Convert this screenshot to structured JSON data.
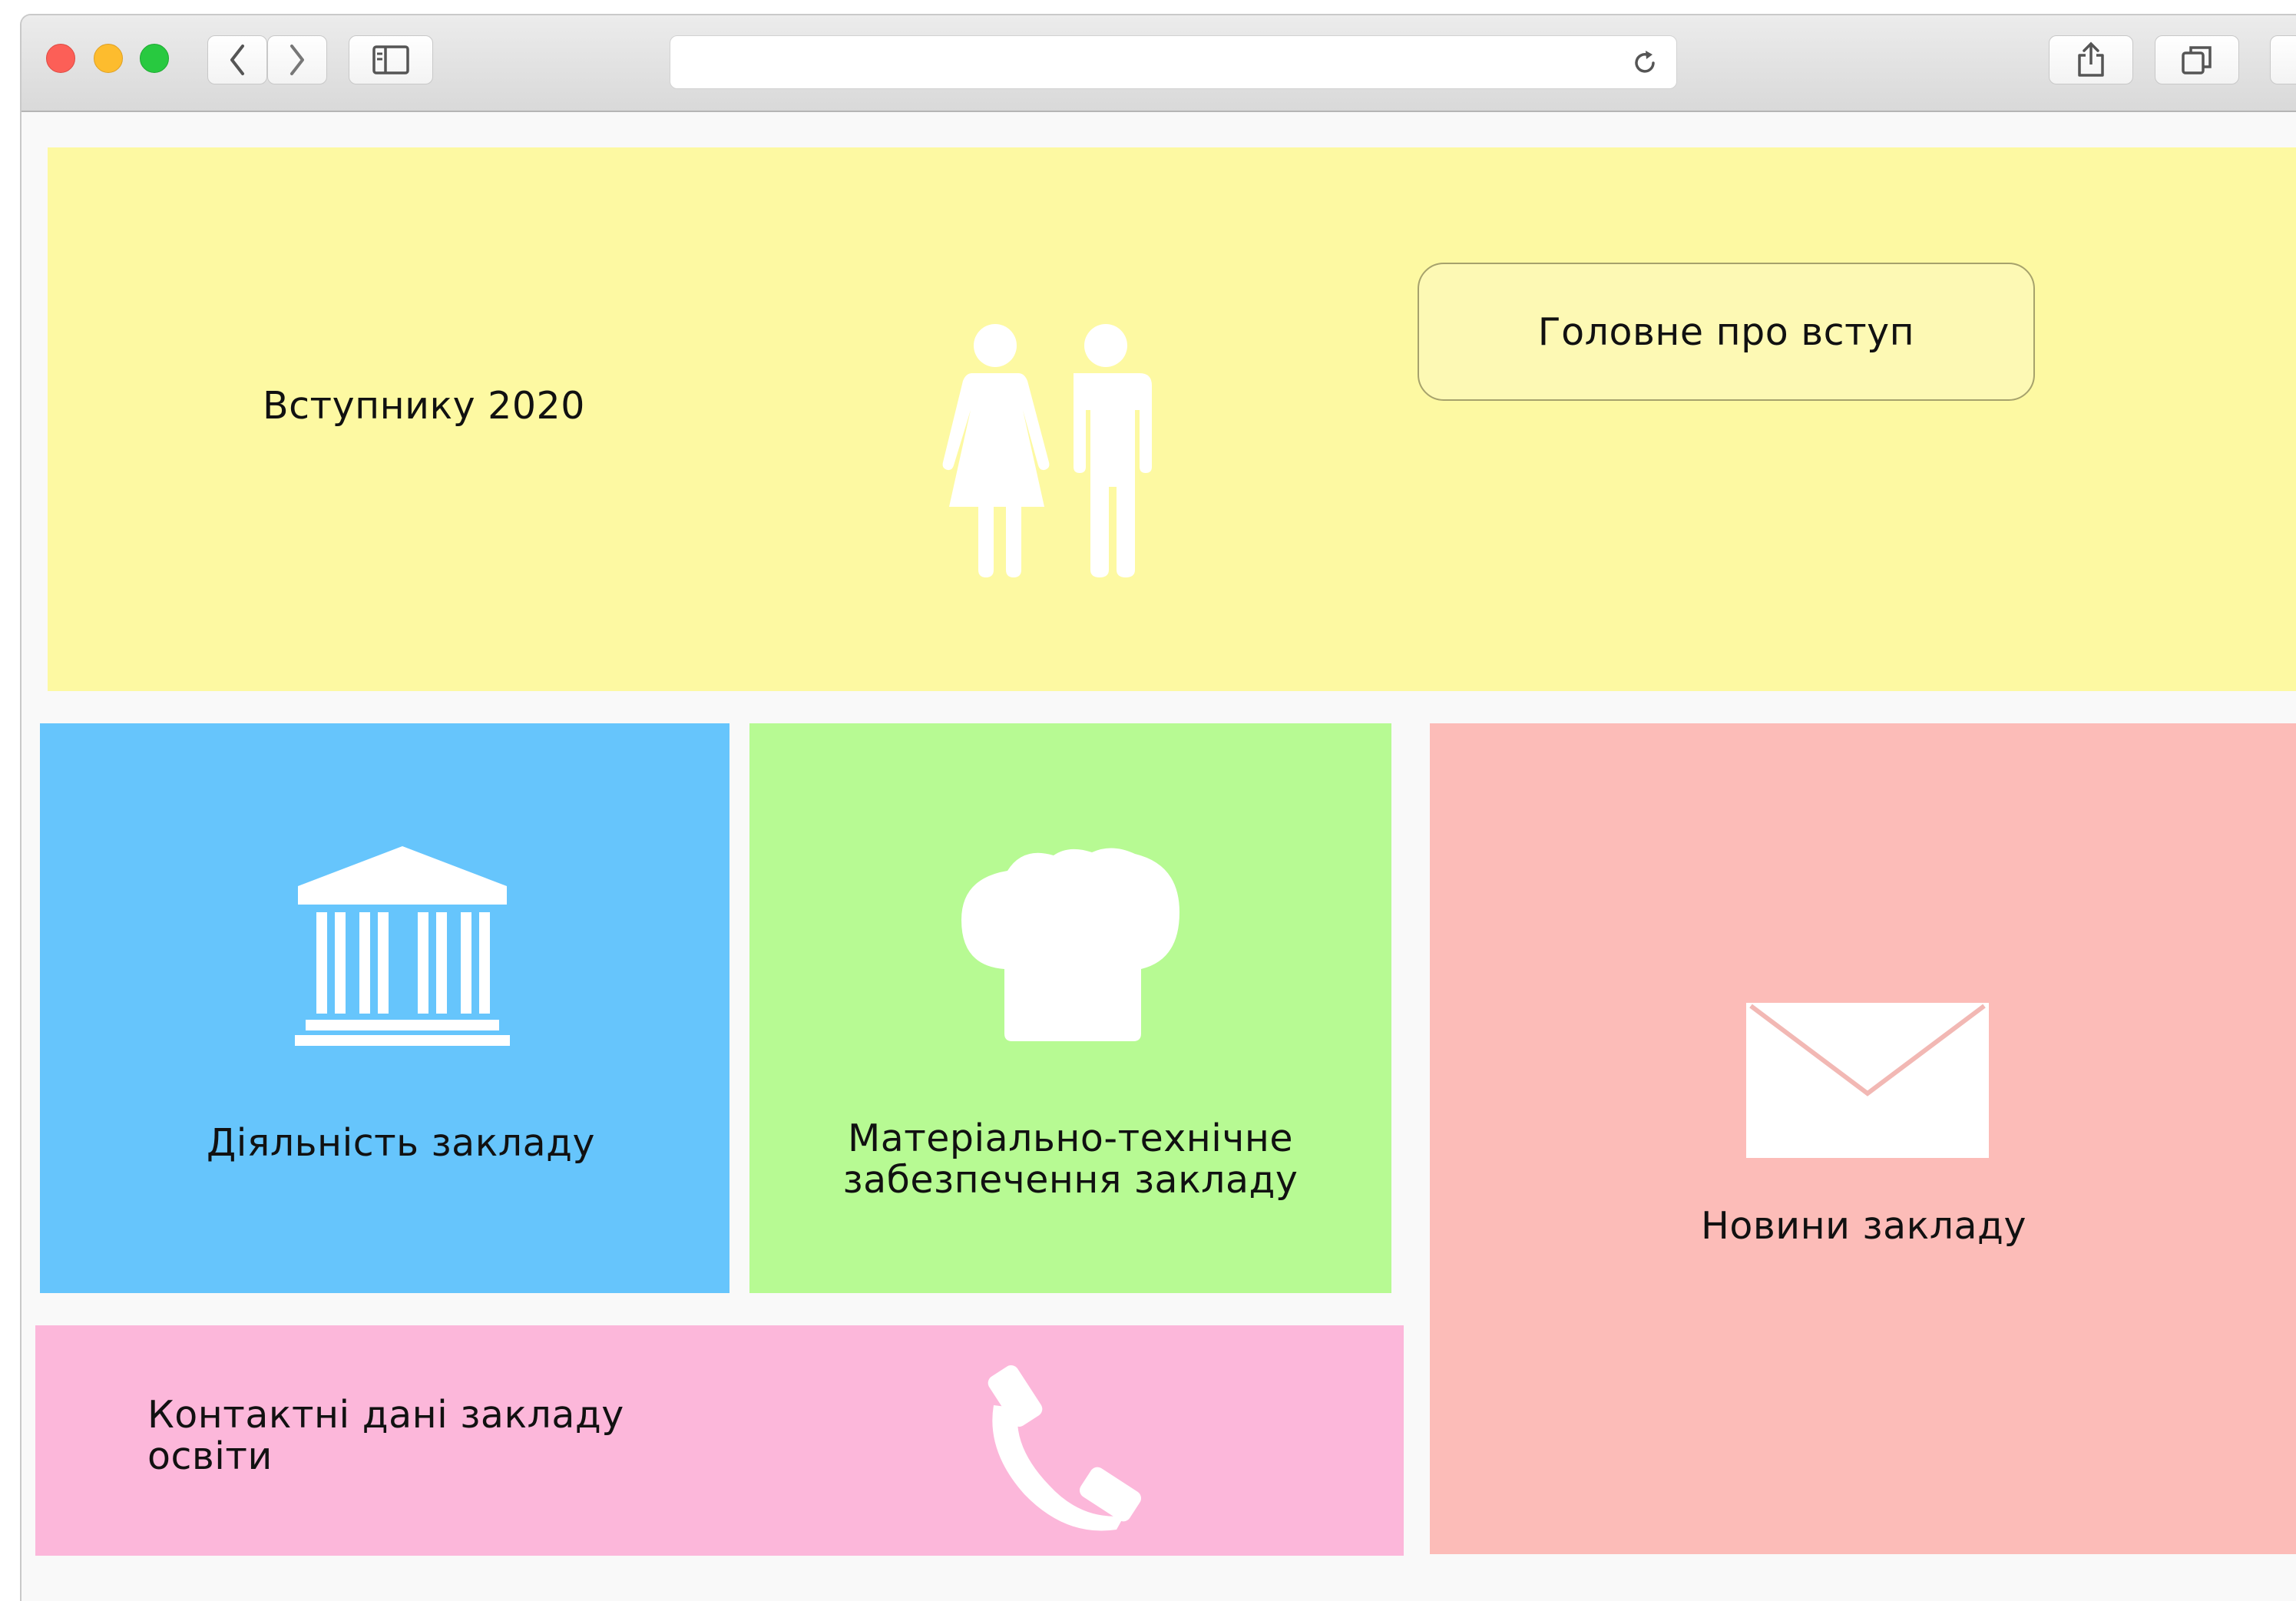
{
  "browser": {
    "nav_icons": [
      "chevron-left-icon",
      "chevron-right-icon",
      "sidebar-icon",
      "reload-icon",
      "share-icon",
      "tabs-icon"
    ]
  },
  "tiles": {
    "admission": {
      "label": "Вступнику 2020",
      "button_label": "Головне про вступ",
      "color": "#fdf9a2",
      "icon": "people-icon"
    },
    "activity": {
      "label": "Діяльність закладу",
      "color": "#66c5fc",
      "icon": "institution-icon"
    },
    "equipment": {
      "label_line1": "Матеріально-технічне",
      "label_line2": "забезпечення закладу",
      "color": "#b7fa93",
      "icon": "chef-hat-icon"
    },
    "news": {
      "label": "Новини закладу",
      "color": "#fcbcb8",
      "icon": "envelope-icon"
    },
    "contacts": {
      "label_line1": "Контактні дані закладу",
      "label_line2": "освіти",
      "color": "#fcb7da",
      "icon": "phone-icon"
    }
  }
}
